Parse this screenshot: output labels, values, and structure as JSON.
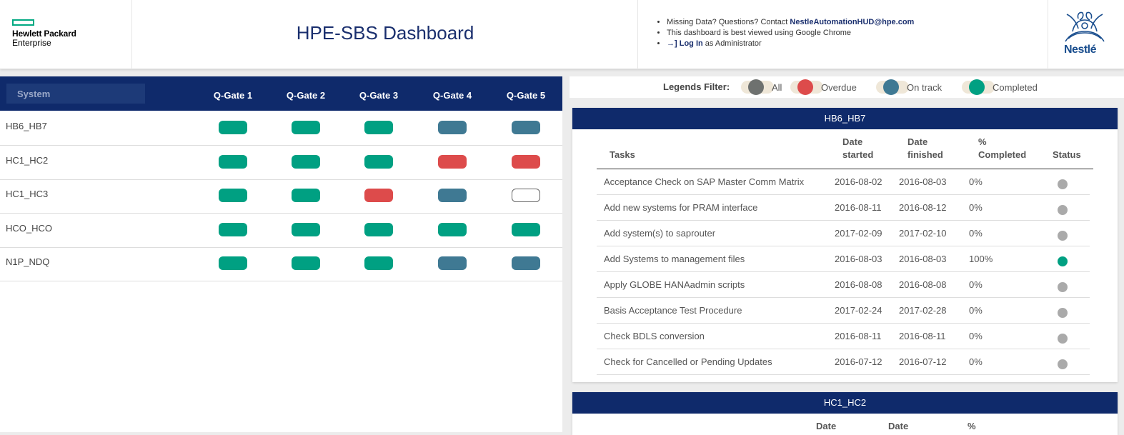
{
  "header": {
    "logo_line1": "Hewlett Packard",
    "logo_line2": "Enterprise",
    "title": "HPE-SBS Dashboard",
    "info1_prefix": "Missing Data? Questions? Contact ",
    "info1_email": "NestleAutomationHUD@hpe.com",
    "info2": "This dashboard is best viewed using Google Chrome",
    "info3_link": "Log In",
    "info3_suffix": " as Administrator",
    "client_logo_text": "Nestlé"
  },
  "systems_table": {
    "system_label": "System",
    "gates": [
      "Q-Gate 1",
      "Q-Gate 2",
      "Q-Gate 3",
      "Q-Gate 4",
      "Q-Gate 5"
    ],
    "rows": [
      {
        "name": "HB6_HB7",
        "statuses": [
          "completed",
          "completed",
          "completed",
          "ontrack",
          "ontrack"
        ]
      },
      {
        "name": "HC1_HC2",
        "statuses": [
          "completed",
          "completed",
          "completed",
          "overdue",
          "overdue"
        ]
      },
      {
        "name": "HC1_HC3",
        "statuses": [
          "completed",
          "completed",
          "overdue",
          "ontrack",
          "empty"
        ]
      },
      {
        "name": "HCO_HCO",
        "statuses": [
          "completed",
          "completed",
          "completed",
          "completed",
          "completed"
        ]
      },
      {
        "name": "N1P_NDQ",
        "statuses": [
          "completed",
          "completed",
          "completed",
          "ontrack",
          "ontrack"
        ]
      }
    ]
  },
  "legend": {
    "title": "Legends Filter:",
    "items": [
      {
        "label": "All",
        "color": "#6e716f"
      },
      {
        "label": "Overdue",
        "color": "#dd4b4b"
      },
      {
        "label": "On track",
        "color": "#3f7993"
      },
      {
        "label": "Completed",
        "color": "#00a082"
      }
    ]
  },
  "status_colors": {
    "completed": "#00a082",
    "overdue": "#dd4b4b",
    "ontrack": "#3f7993",
    "pending": "#aaaaaa"
  },
  "detail_cards": [
    {
      "system": "HB6_HB7",
      "headers": {
        "tasks": "Tasks",
        "date_started_1": "Date",
        "date_started_2": "started",
        "date_finished_1": "Date",
        "date_finished_2": "finished",
        "pct_1": "%",
        "pct_2": "Completed",
        "status": "Status"
      },
      "tasks": [
        {
          "name": "Acceptance Check on SAP Master Comm Matrix",
          "started": "2016-08-02",
          "finished": "2016-08-03",
          "pct": "0%",
          "status": "pending"
        },
        {
          "name": "Add new systems for PRAM interface",
          "started": "2016-08-11",
          "finished": "2016-08-12",
          "pct": "0%",
          "status": "pending"
        },
        {
          "name": "Add system(s) to saprouter",
          "started": "2017-02-09",
          "finished": "2017-02-10",
          "pct": "0%",
          "status": "pending"
        },
        {
          "name": "Add Systems to management files",
          "started": "2016-08-03",
          "finished": "2016-08-03",
          "pct": "100%",
          "status": "done"
        },
        {
          "name": "Apply GLOBE HANAadmin scripts",
          "started": "2016-08-08",
          "finished": "2016-08-08",
          "pct": "0%",
          "status": "pending"
        },
        {
          "name": "Basis Acceptance Test Procedure",
          "started": "2017-02-24",
          "finished": "2017-02-28",
          "pct": "0%",
          "status": "pending"
        },
        {
          "name": "Check BDLS conversion",
          "started": "2016-08-11",
          "finished": "2016-08-11",
          "pct": "0%",
          "status": "pending"
        },
        {
          "name": "Check for Cancelled or Pending Updates",
          "started": "2016-07-12",
          "finished": "2016-07-12",
          "pct": "0%",
          "status": "pending"
        }
      ]
    },
    {
      "system": "HC1_HC2",
      "headers": {
        "date_started_1": "Date",
        "date_finished_1": "Date",
        "pct_1": "%"
      }
    }
  ]
}
